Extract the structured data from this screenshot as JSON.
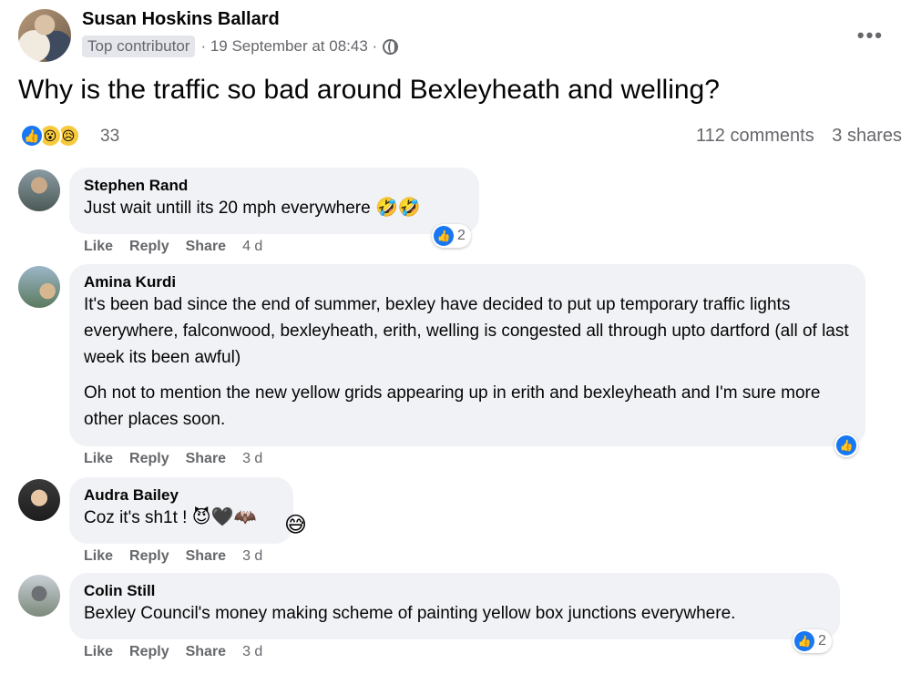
{
  "post": {
    "author": "Susan Hoskins Ballard",
    "badge": "Top contributor",
    "meta": "· 19 September at 08:43 ·",
    "more": "•••",
    "text": "Why is the traffic so bad around Bexleyheath and welling?",
    "reaction_count": "33",
    "comments": "112 comments",
    "shares": "3 shares"
  },
  "comments": [
    {
      "name": "Stephen Rand",
      "text": "Just wait untill its 20 mph everywhere",
      "emoji": "🤣🤣",
      "like": "Like",
      "reply": "Reply",
      "share": "Share",
      "time": "4 d",
      "reactions": "2"
    },
    {
      "name": "Amina Kurdi",
      "text": "It's been bad since the end of summer, bexley have decided to put up temporary traffic lights everywhere, falconwood, bexleyheath, erith, welling is congested all through upto dartford (all of last week its been awful)",
      "text2": "Oh not to mention the new yellow grids appearing up in erith and bexleyheath and I'm sure more other places soon.",
      "like": "Like",
      "reply": "Reply",
      "share": "Share",
      "time": "3 d"
    },
    {
      "name": "Audra Bailey",
      "text": "Coz it's sh1t !",
      "emoji": "😈🖤🦇",
      "reaction_emoji": "😅",
      "like": "Like",
      "reply": "Reply",
      "share": "Share",
      "time": "3 d"
    },
    {
      "name": "Colin Still",
      "text": "Bexley Council's money making scheme of painting yellow box junctions everywhere.",
      "like": "Like",
      "reply": "Reply",
      "share": "Share",
      "time": "3 d",
      "reactions": "2"
    }
  ],
  "colors": {
    "accent": "#1877f2",
    "bubble": "#f0f2f5",
    "secondary_text": "#65676b"
  }
}
